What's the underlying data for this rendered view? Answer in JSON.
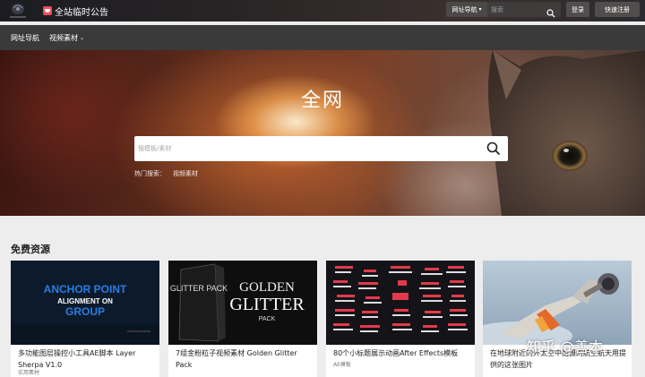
{
  "header": {
    "notice": "全站临时公告",
    "nav_select": "网址导航",
    "search_placeholder": "搜索",
    "login": "登录",
    "register": "快速注册"
  },
  "subnav": {
    "items": [
      {
        "label": "网址导航"
      },
      {
        "label": "视频素材"
      }
    ]
  },
  "hero": {
    "title": "全网",
    "search_placeholder": "搜模板/素材",
    "hot_label": "热门搜索：",
    "hot_link": "视频素材"
  },
  "section": {
    "title": "免费资源"
  },
  "cards": [
    {
      "title": "多功能图层操控小工具AE脚本 Layer Sherpa V1.0",
      "tag": "实用素材",
      "thumb_text_1": "ANCHOR POINT",
      "thumb_text_2": "ALIGNMENT ON",
      "thumb_text_3": "GROUP"
    },
    {
      "title": "7组金粉粒子视频素材 Golden Glitter Pack",
      "tag": "",
      "thumb_text_1": "GOLDEN",
      "thumb_text_2": "GLITTER",
      "thumb_text_3": "PACK",
      "box_text": "GLITTER PACK"
    },
    {
      "title": "80个小标题展示动画After Effects模板",
      "tag": "AE模板"
    },
    {
      "title": "在地球附近的外太空中拍摄的航空航天用提供的这张图片",
      "tag": ""
    }
  ],
  "watermark": "知乎 @善本",
  "colors": {
    "topbar": "#1b1c21",
    "subnav": "#3a3a3a",
    "card_dark_blue": "#0c1a2c",
    "anchor_blue": "#2b7de0"
  }
}
